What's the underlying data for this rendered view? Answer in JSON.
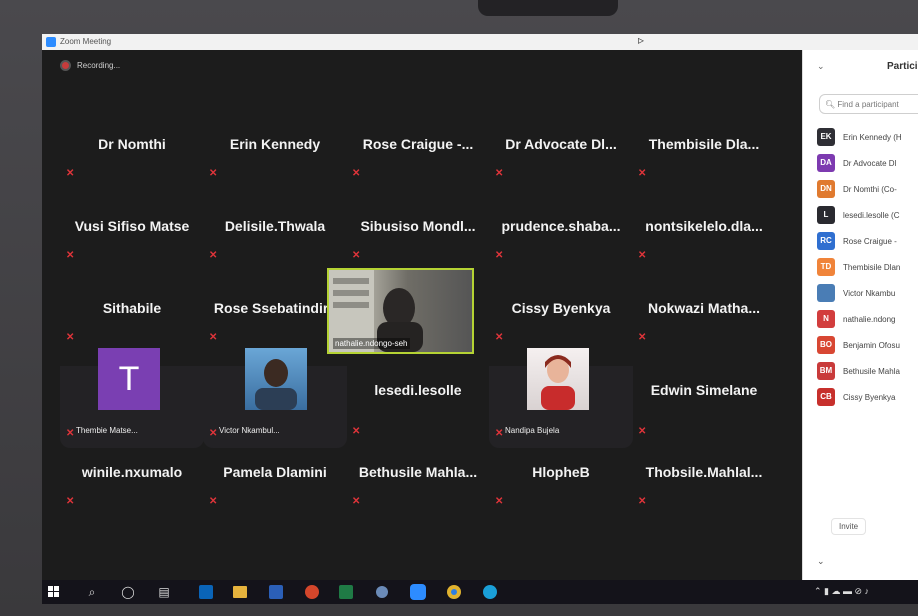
{
  "window": {
    "title": "Zoom Meeting"
  },
  "recording": {
    "label": "Recording..."
  },
  "tiles": [
    {
      "name": "Dr Nomthi"
    },
    {
      "name": "Erin Kennedy"
    },
    {
      "name": "Rose Craigue -..."
    },
    {
      "name": "Dr Advocate Dl..."
    },
    {
      "name": "Thembisile Dla..."
    },
    {
      "name": "Vusi Sifiso Matse"
    },
    {
      "name": "Delisile.Thwala"
    },
    {
      "name": "Sibusiso Mondl..."
    },
    {
      "name": "prudence.shaba..."
    },
    {
      "name": "nontsikelelo.dla..."
    },
    {
      "name": "Sithabile"
    },
    {
      "name": "Rose Ssebatindira"
    },
    {
      "name": "nathalie.ndongo-seh"
    },
    {
      "name": "Cissy Byenkya"
    },
    {
      "name": "Nokwazi Matha..."
    },
    {
      "name": "Thembie Matse...",
      "avatar_letter": "T"
    },
    {
      "name": "Victor Nkambul..."
    },
    {
      "name": "lesedi.lesolle"
    },
    {
      "name": "Nandipa Bujela"
    },
    {
      "name": "Edwin Simelane"
    },
    {
      "name": "winile.nxumalo"
    },
    {
      "name": "Pamela Dlamini"
    },
    {
      "name": "Bethusile Mahla..."
    },
    {
      "name": "HlopheB"
    },
    {
      "name": "Thobsile.Mahlal..."
    }
  ],
  "participants_panel": {
    "title": "Partici",
    "search_placeholder": "Find a participant",
    "invite_label": "Invite",
    "list": [
      {
        "initials": "EK",
        "name": "Erin Kennedy (H",
        "color": "#2f2f35"
      },
      {
        "initials": "DA",
        "name": "Dr Advocate Dl",
        "color": "#7d3ab0"
      },
      {
        "initials": "DN",
        "name": "Dr Nomthi (Co-",
        "color": "#e07a2f"
      },
      {
        "initials": "L",
        "name": "lesedi.lesolle (C",
        "color": "#2a2a30"
      },
      {
        "initials": "RC",
        "name": "Rose Craigue -",
        "color": "#2f6fd0"
      },
      {
        "initials": "TD",
        "name": "Thembisile Dlan",
        "color": "#f0843a"
      },
      {
        "initials": "",
        "name": "Victor Nkambu",
        "color": "#4a7db5"
      },
      {
        "initials": "N",
        "name": "nathalie.ndong",
        "color": "#d23d3d"
      },
      {
        "initials": "BO",
        "name": "Benjamin Ofosu",
        "color": "#d84733"
      },
      {
        "initials": "BM",
        "name": "Bethusile Mahla",
        "color": "#c93b3b"
      },
      {
        "initials": "CB",
        "name": "Cissy Byenkya",
        "color": "#c7302c"
      }
    ]
  }
}
